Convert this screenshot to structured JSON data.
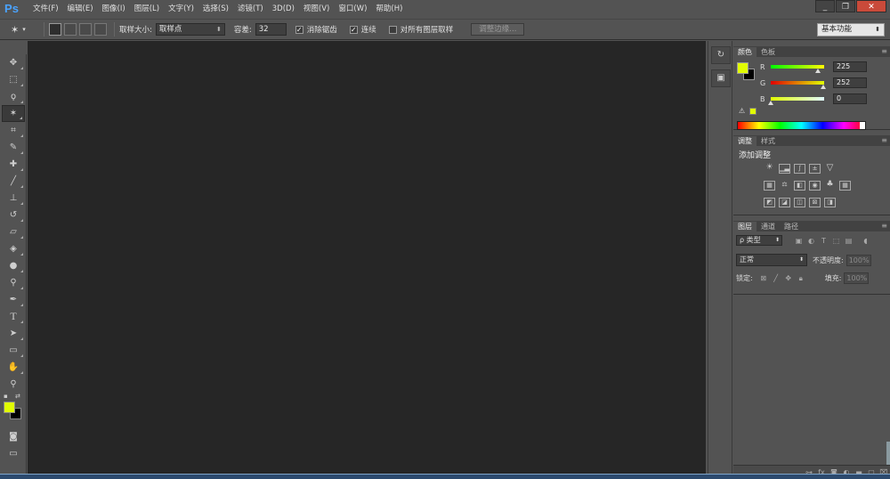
{
  "app": {
    "logo": "Ps"
  },
  "menu": [
    "文件(F)",
    "编辑(E)",
    "图像(I)",
    "图层(L)",
    "文字(Y)",
    "选择(S)",
    "滤镜(T)",
    "3D(D)",
    "视图(V)",
    "窗口(W)",
    "帮助(H)"
  ],
  "window_controls": {
    "minimize": "_",
    "restore": "❐",
    "close": "✕"
  },
  "options": {
    "sample_size_label": "取样大小:",
    "sample_size_value": "取样点",
    "tolerance_label": "容差:",
    "tolerance_value": "32",
    "antialias_label": "消除锯齿",
    "antialias_checked": true,
    "contiguous_label": "连续",
    "contiguous_checked": true,
    "all_layers_label": "对所有图层取样",
    "all_layers_checked": false,
    "refine_edge_label": "调整边缘...",
    "workspace": "基本功能"
  },
  "colors": {
    "foreground": "#e1fc00",
    "background": "#000000"
  },
  "color_panel": {
    "tabs": [
      "颜色",
      "色板"
    ],
    "r_label": "R",
    "r_value": "225",
    "g_label": "G",
    "g_value": "252",
    "b_label": "B",
    "b_value": "0"
  },
  "adjustments_panel": {
    "tabs": [
      "调整",
      "样式"
    ],
    "title": "添加调整"
  },
  "layers_panel": {
    "tabs": [
      "图层",
      "通道",
      "路径"
    ],
    "filter_kind": "ρ 类型",
    "blend_mode": "正常",
    "opacity_label": "不透明度:",
    "opacity_value": "100%",
    "lock_label": "锁定:",
    "fill_label": "填充:",
    "fill_value": "100%"
  }
}
